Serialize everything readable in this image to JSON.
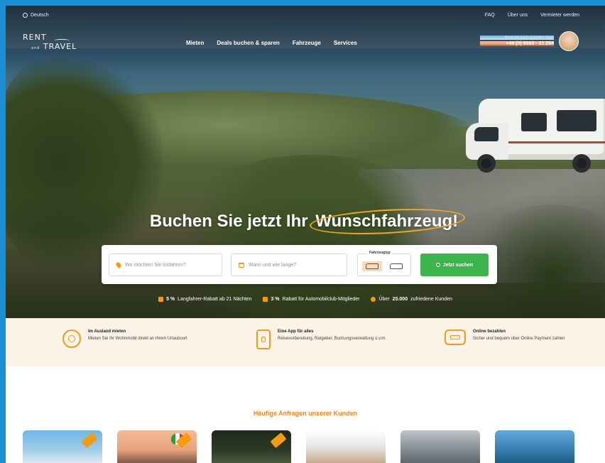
{
  "topbar": {
    "language": "Deutsch",
    "links": [
      "FAQ",
      "Über uns",
      "Vermieter werden"
    ]
  },
  "navbar": {
    "logo_line1": "RENT",
    "logo_line2": "TRAVEL",
    "logo_amp": "and",
    "items": [
      "Mieten",
      "Deals buchen & sparen",
      "Fahrzeuge",
      "Services"
    ],
    "contact_caption": "Beratung durch Experten Team",
    "contact_phone": "+49 (0) 8583 - 21 264"
  },
  "hero": {
    "headline_prefix": "Buchen Sie jetzt Ihr",
    "headline_highlight": "Wunschfahrzeug!"
  },
  "search": {
    "where_placeholder": "Wo möchten Sie losfahren?",
    "when_placeholder": "Wann und wie lange?",
    "vehicle_type_label": "Fahrzeugtyp",
    "submit_label": "Jetzt suchen"
  },
  "perks": [
    {
      "bold": "5 %",
      "text": "Langfahrer-Rabatt ab 21 Nächten"
    },
    {
      "bold": "3 %",
      "text": "Rabatt für Automobilclub-Mitglieder"
    },
    {
      "prefix": "Über",
      "bold": "25.000",
      "text": "zufriedene Kunden"
    }
  ],
  "features": [
    {
      "title": "Im Ausland mieten",
      "desc": "Mieten Sie Ihr Wohnmobil direkt an Ihrem Urlaubsort",
      "icon": "globe-icon"
    },
    {
      "title": "Eine App für alles",
      "desc": "Reisevorbereitung, Ratgeber, Buchungsverwaltung u.v.m.",
      "icon": "smartphone-icon"
    },
    {
      "title": "Online bezahlen",
      "desc": "Sicher und bequem über Online Payment zahlen",
      "icon": "payment-icon"
    }
  ],
  "faq_section": {
    "title": "Häufige Anfragen unserer Kunden"
  },
  "colors": {
    "accent_orange": "#f39c12",
    "cta_green": "#3bb54a",
    "feature_bg": "#fbf3e8",
    "section_title": "#e8861e"
  }
}
